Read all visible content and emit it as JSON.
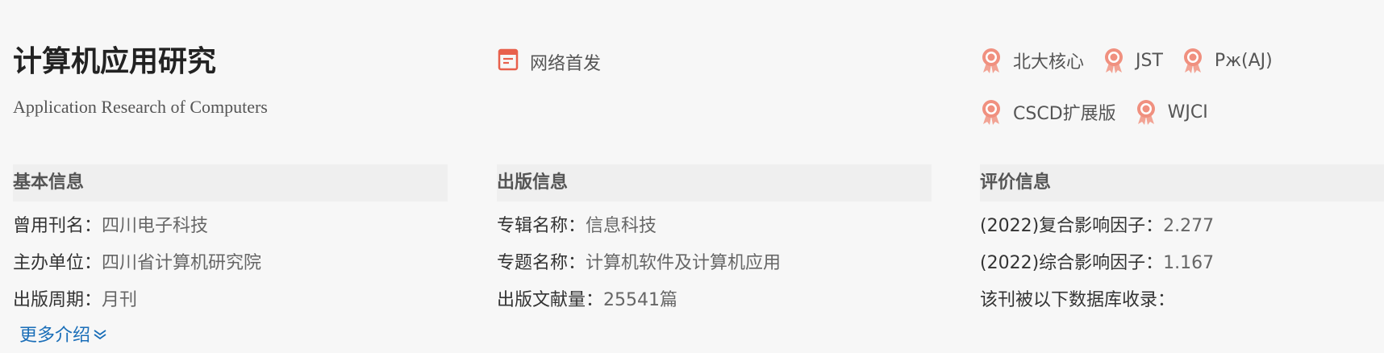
{
  "journal": {
    "title_cn": "计算机应用研究",
    "title_en": "Application Research of Computers",
    "first_publish_label": "网络首发"
  },
  "tags": [
    {
      "label": "北大核心"
    },
    {
      "label": "JST"
    },
    {
      "label": "Рж(AJ)"
    },
    {
      "label": "CSCD扩展版"
    },
    {
      "label": "WJCI"
    }
  ],
  "basic_info": {
    "header": "基本信息",
    "rows": [
      {
        "label": "曾用刊名：",
        "value": "四川电子科技"
      },
      {
        "label": "主办单位：",
        "value": "四川省计算机研究院"
      },
      {
        "label": "出版周期：",
        "value": "月刊"
      }
    ],
    "more_label": "更多介绍"
  },
  "pub_info": {
    "header": "出版信息",
    "rows": [
      {
        "label": "专辑名称：",
        "value": "信息科技"
      },
      {
        "label": "专题名称：",
        "value": "计算机软件及计算机应用"
      },
      {
        "label": "出版文献量：",
        "value": "25541篇"
      }
    ]
  },
  "eval_info": {
    "header": "评价信息",
    "rows": [
      {
        "label": "(2022)复合影响因子：",
        "value": "2.277"
      },
      {
        "label": "(2022)综合影响因子：",
        "value": "1.167"
      },
      {
        "label": "该刊被以下数据库收录：",
        "value": ""
      }
    ]
  },
  "colors": {
    "background": "#f7f7f7",
    "accent_icon": "#e8604c",
    "link": "#1a6eb8"
  },
  "icons": {
    "first_publish": "document-icon",
    "tag": "award-ribbon-icon",
    "more": "double-chevron-down-icon"
  }
}
